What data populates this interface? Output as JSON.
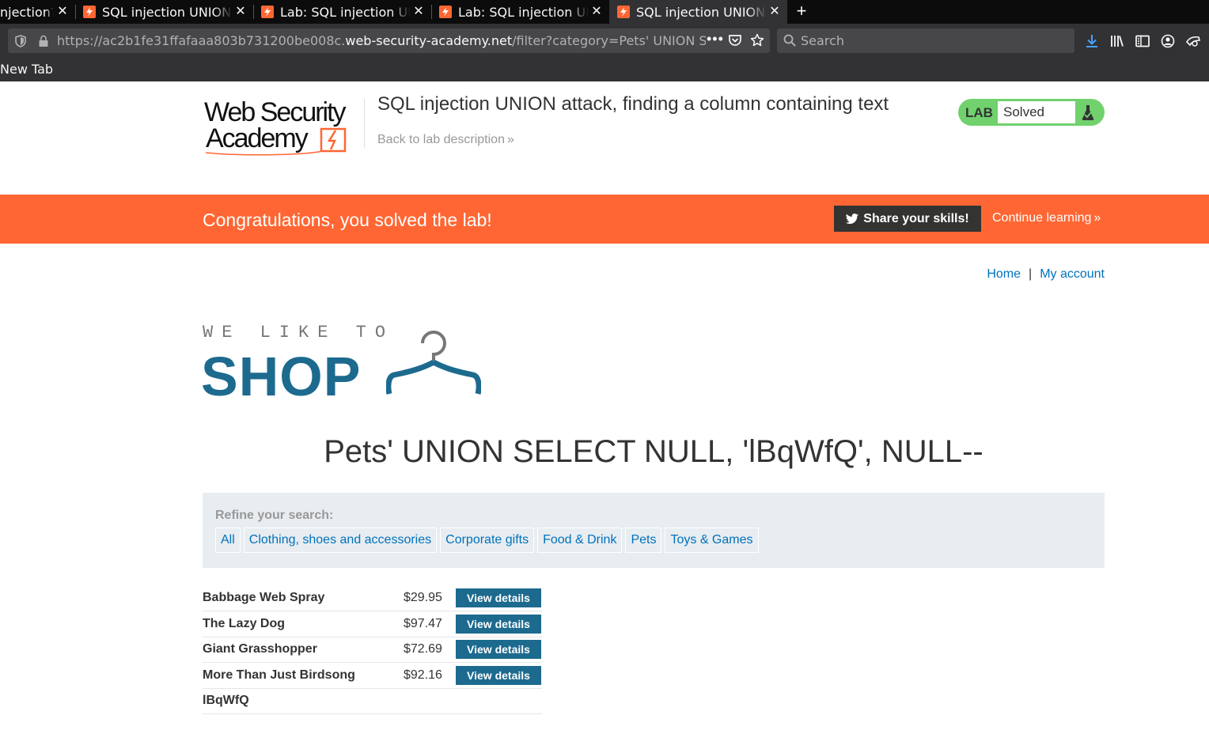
{
  "browser": {
    "tabs": [
      {
        "title": "njection?"
      },
      {
        "title": "SQL injection UNION attack"
      },
      {
        "title": "Lab: SQL injection UNION"
      },
      {
        "title": "Lab: SQL injection UNION"
      },
      {
        "title": "SQL injection UNION attack"
      }
    ],
    "url": {
      "prefix": "https://ac2b1fe31ffafaaa803b731200be008c.",
      "domain": "web-security-academy.net",
      "path": "/filter?category=Pets' UNION SELECT NULL, 'lBqWfQ', NULL--"
    },
    "search_placeholder": "Search",
    "bookmark": "New Tab"
  },
  "lab": {
    "title": "SQL injection UNION attack, finding a column containing text",
    "back_link": "Back to lab description",
    "badge_label": "LAB",
    "status": "Solved"
  },
  "banner": {
    "message": "Congratulations, you solved the lab!",
    "share": "Share your skills!",
    "continue": "Continue learning"
  },
  "nav": {
    "home": "Home",
    "separator": "|",
    "account": "My account"
  },
  "shop": {
    "small": "WE LIKE TO",
    "big": "SHOP"
  },
  "heading": "Pets' UNION SELECT NULL, 'lBqWfQ', NULL--",
  "filter": {
    "label": "Refine your search:",
    "categories": [
      "All",
      "Clothing, shoes and accessories",
      "Corporate gifts",
      "Food & Drink",
      "Pets",
      "Toys & Games"
    ]
  },
  "products": [
    {
      "name": "Babbage Web Spray",
      "price": "$29.95",
      "button": "View details"
    },
    {
      "name": "The Lazy Dog",
      "price": "$97.47",
      "button": "View details"
    },
    {
      "name": "Giant Grasshopper",
      "price": "$72.69",
      "button": "View details"
    },
    {
      "name": "More Than Just Birdsong",
      "price": "$92.16",
      "button": "View details"
    },
    {
      "name": "lBqWfQ"
    }
  ],
  "colors": {
    "accent": "#ff6633",
    "link": "#0071bc",
    "button": "#1d6a8f",
    "lab_green": "#70d16d"
  }
}
